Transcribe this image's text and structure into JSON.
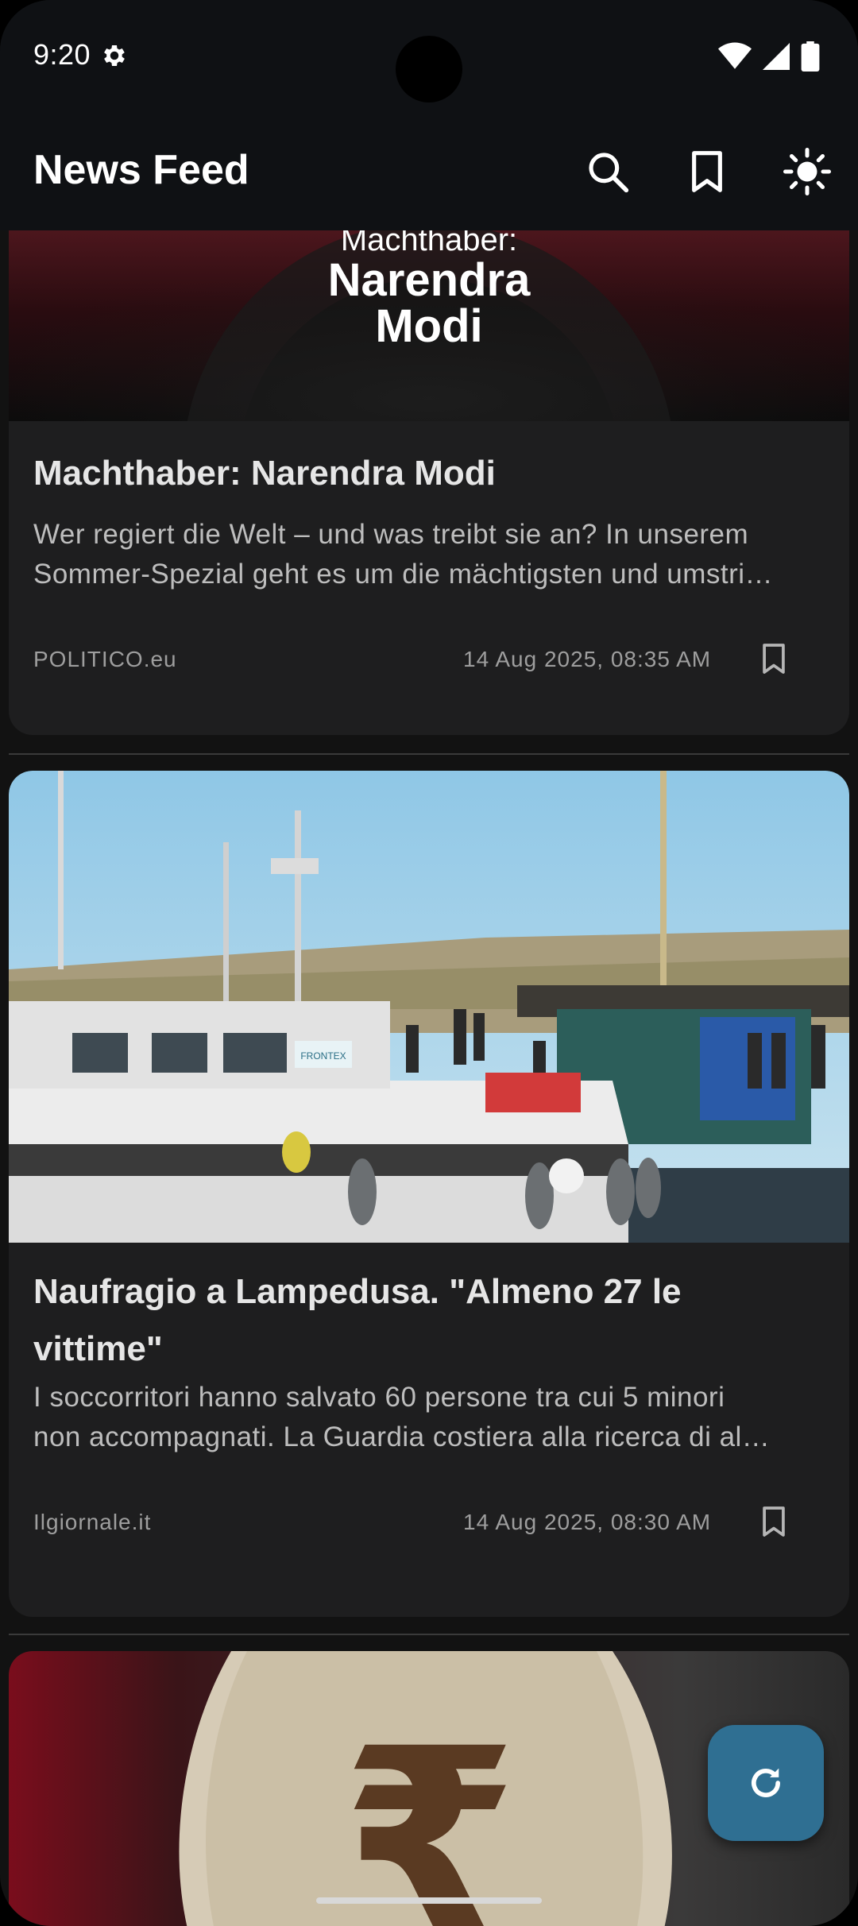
{
  "status_bar": {
    "time": "9:20",
    "icons": [
      "gear-icon",
      "wifi-icon",
      "signal-icon",
      "battery-icon"
    ]
  },
  "app_bar": {
    "title": "News Feed",
    "actions": [
      "search-icon",
      "bookmarks-icon",
      "theme-toggle-icon"
    ]
  },
  "articles": [
    {
      "image_caption_top": "Machthaber:",
      "image_caption_main_1": "Narendra",
      "image_caption_main_2": "Modi",
      "title": "Machthaber: Narendra Modi",
      "description_line1": "Wer regiert die Welt – und was treibt sie an? In unserem",
      "description_line2": "Sommer-Spezial geht es um die mächtigsten und umstri…",
      "source": "POLITICO.eu",
      "date": "14 Aug 2025, 08:35 AM"
    },
    {
      "title_line1": "Naufragio a Lampedusa. \"Almeno 27 le",
      "title_line2": "vittime\"",
      "description_line1": "I soccorritori hanno salvato 60 persone tra cui 5 minori",
      "description_line2": "non accompagnati. La Guardia costiera alla ricerca di al…",
      "source": "Ilgiornale.it",
      "date": "14 Aug 2025, 08:30 AM",
      "image_label": "FRONTEX"
    },
    {
      "image_symbol": "₹"
    }
  ],
  "colors": {
    "background": "#121212",
    "card": "#1e1e1f",
    "appbar": "#0f1114",
    "fab": "#2f6f92"
  }
}
